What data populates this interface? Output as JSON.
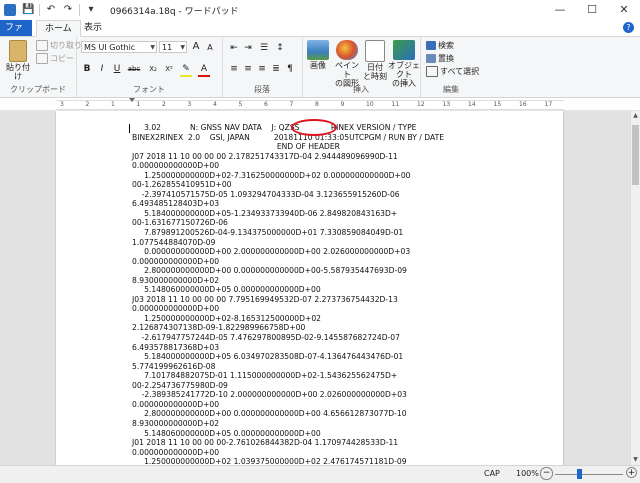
{
  "window": {
    "title": "0966314a.18q - ワードパッド",
    "minimize_glyph": "—",
    "maximize_glyph": "☐",
    "close_glyph": "✕"
  },
  "quick_access": {
    "save_glyph": "💾",
    "undo_glyph": "↶",
    "redo_glyph": "↷",
    "dropdown_glyph": "▾"
  },
  "tabs": {
    "file": "ファイル",
    "home": "ホーム",
    "view": "表示",
    "help_glyph": "?"
  },
  "ribbon": {
    "clipboard": {
      "label": "クリップボード",
      "paste": "貼り付け",
      "cut": "切り取り",
      "copy": "コピー"
    },
    "font": {
      "label": "フォント",
      "family": "MS UI Gothic",
      "size": "11",
      "grow_glyph": "A",
      "shrink_glyph": "A",
      "bold": "B",
      "italic": "I",
      "underline": "U",
      "strike": "abc",
      "subscript": "X₂",
      "superscript": "X²"
    },
    "paragraph": {
      "label": "段落"
    },
    "insert": {
      "label": "挿入",
      "picture": "画像",
      "paint_line1": "ペイント",
      "paint_line2": "の図形",
      "datetime_line1": "日付",
      "datetime_line2": "と時刻",
      "object_line1": "オブジェクト",
      "object_line2": "の挿入"
    },
    "edit": {
      "label": "編集",
      "find": "検索",
      "replace": "置換",
      "select_all": "すべて選択"
    }
  },
  "ruler": {
    "ticks": [
      "3",
      "2",
      "1",
      "1",
      "2",
      "3",
      "4",
      "5",
      "6",
      "7",
      "8",
      "9",
      "10",
      "11",
      "12",
      "13",
      "14",
      "15",
      "16",
      "17"
    ]
  },
  "document": {
    "lines": [
      "     3.02            N: GNSS NAV DATA    J: QZSS             RINEX VERSION / TYPE",
      "BINEX2RINEX  2.0    GSI, JAPAN          20181110 01:33:05UTCPGM / RUN BY / DATE",
      "                                                            END OF HEADER",
      "J07 2018 11 10 00 00 00 2.178251743317D-04 2.944489096990D-11",
      "0.000000000000D+00",
      "     1.250000000000D+02-7.316250000000D+02 0.000000000000D+00",
      "00-1.262855410951D+00",
      "    -2.397410571575D-05 1.093294704333D-04 3.123655915260D-06",
      "6.493485128403D+03",
      "     5.184000000000D+05-1.234933733940D-06 2.849820843163D+",
      "00-1.631677150726D-06",
      "     7.879891200526D-04-9.134375000000D+01 7.330859084049D-01",
      "1.077544884070D-09",
      "     0.000000000000D+00 2.000000000000D+00 2.026000000000D+03",
      "0.000000000000D+00",
      "     2.800000000000D+00 0.000000000000D+00-5.587935447693D-09",
      "8.930000000000D+02",
      "     5.148060000000D+05 0.000000000000D+00",
      "J03 2018 11 10 00 00 00 7.795169949532D-07 2.273736754432D-13",
      "0.000000000000D+00",
      "     1.250000000000D+02-8.165312500000D+02",
      "2.126874307138D-09-1.822989966758D+00",
      "    -2.617947757244D-05 7.476297800895D-02-9.145587682724D-07",
      "6.493578817368D+03",
      "     5.184000000000D+05 6.034970283508D-07-4.136476443476D-01",
      "5.774199962616D-08",
      "     7.101784882075D-01 1.115000000000D+02-1.543625562475D+",
      "00-2.254736775980D-09",
      "    -2.389385241772D-10 2.000000000000D+00 2.026000000000D+03",
      "0.000000000000D+00",
      "     2.800000000000D+00 0.000000000000D+00 4.656612873077D-10",
      "8.930000000000D+02",
      "     5.148060000000D+05 0.000000000000D+00",
      "J01 2018 11 10 00 00 00-2.761026844382D-04 1.170974428533D-11",
      "0.000000000000D+00",
      "     1.250000000000D+02 1.039375000000D+02 2.476174571181D-09"
    ]
  },
  "status": {
    "caps": "CAP",
    "zoom": "100%",
    "minus_glyph": "−",
    "plus_glyph": "+"
  },
  "colors": {
    "file_tab": "#1e65c9",
    "highlight_ring": "#e0141d"
  }
}
